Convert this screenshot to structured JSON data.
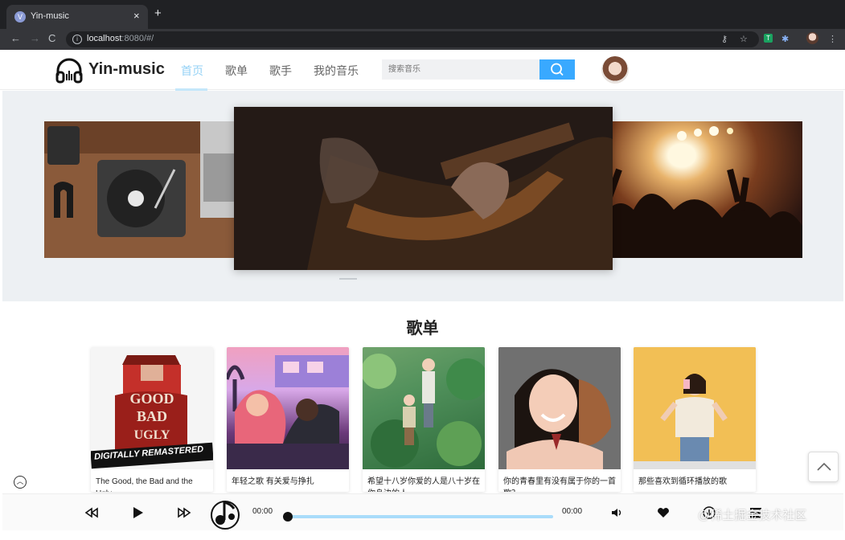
{
  "browser": {
    "tab_title": "Yin-music",
    "tab_close": "×",
    "new_tab": "+",
    "url_host": "localhost",
    "url_rest": ":8080/#/"
  },
  "header": {
    "logo_text": "Yin-music",
    "nav": [
      "首页",
      "歌单",
      "歌手",
      "我的音乐"
    ],
    "active_nav_index": 0,
    "search_placeholder": "搜索音乐"
  },
  "carousel": {
    "slides": 3,
    "active_index": 1
  },
  "playlists": {
    "title": "歌单",
    "cover_1_banner": "DIGITALLY REMASTERED",
    "items": [
      {
        "title": "The Good, the Bad and the Ugly"
      },
      {
        "title": "年轻之歌 有关爱与挣扎"
      },
      {
        "title": "希望十八岁你爱的人是八十岁在你身边的人"
      },
      {
        "title": "你的青春里有没有属于你的一首歌？"
      },
      {
        "title": "那些喜欢到循环播放的歌"
      }
    ]
  },
  "player": {
    "current_time": "00:00",
    "total_time": "00:00",
    "progress": 0
  },
  "watermark": "@稀土掘金技术社区",
  "colors": {
    "accent": "#39a9ff",
    "nav_active": "#95d2f6",
    "progress_track": "#a9dcfa"
  }
}
